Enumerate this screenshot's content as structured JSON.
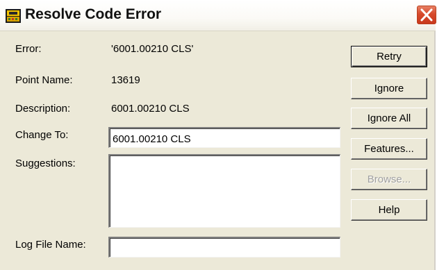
{
  "window": {
    "title": "Resolve Code Error",
    "icon": "survey-app-icon",
    "close_icon": "close-icon"
  },
  "fields": {
    "error_label": "Error:",
    "error_value": "'6001.00210 CLS'",
    "point_name_label": "Point Name:",
    "point_name_value": "13619",
    "description_label": "Description:",
    "description_value": "6001.00210 CLS",
    "change_to_label": "Change To:",
    "change_to_value": "6001.00210 CLS",
    "suggestions_label": "Suggestions:",
    "suggestions_items": [],
    "log_file_label": "Log File Name:",
    "log_file_value": ""
  },
  "buttons": {
    "retry": "Retry",
    "ignore": "Ignore",
    "ignore_all": "Ignore All",
    "features": "Features...",
    "browse": "Browse...",
    "help": "Help"
  },
  "colors": {
    "dialog_bg": "#ece9d8",
    "close_button": "#d74a2c"
  }
}
